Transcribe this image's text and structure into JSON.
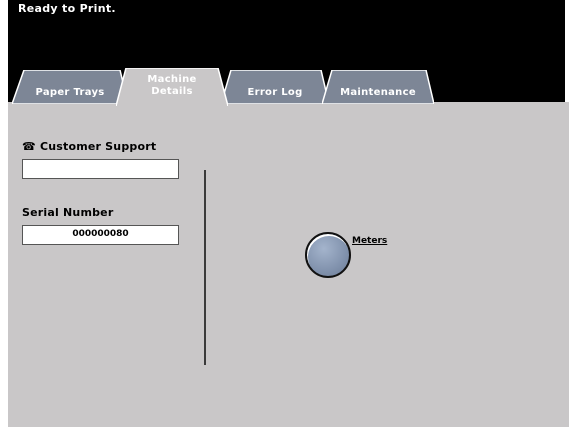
{
  "status_bar": {
    "message": "Ready to Print."
  },
  "tabs": [
    {
      "label": "Paper Trays",
      "active": false
    },
    {
      "label_line1": "Machine",
      "label_line2": "Details",
      "active": true
    },
    {
      "label": "Error Log",
      "active": false
    },
    {
      "label": "Maintenance",
      "active": false
    }
  ],
  "customer_support": {
    "label": "Customer Support",
    "value": ""
  },
  "serial_number": {
    "label": "Serial Number",
    "value": "000000080"
  },
  "meters": {
    "label": "Meters"
  },
  "colors": {
    "background": "#000000",
    "panel": "#c9c7c8",
    "tab_inactive": "#7d8696",
    "tab_active": "#c9c7c8",
    "button": "#8192ad"
  }
}
